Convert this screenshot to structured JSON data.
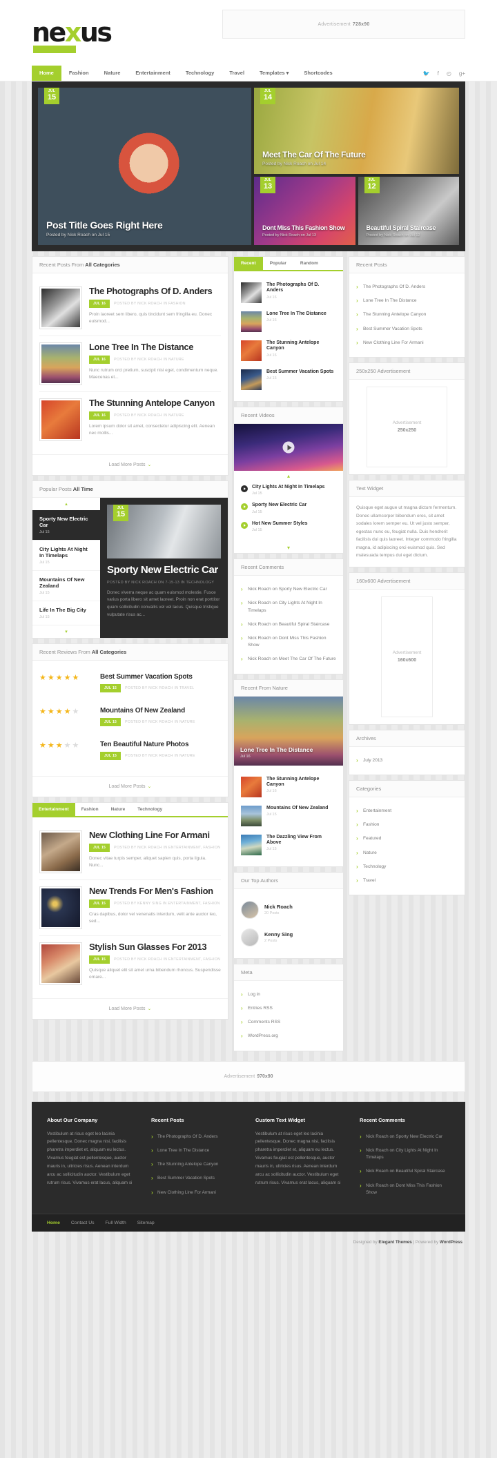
{
  "header": {
    "logo": "nexus",
    "logo_accent_letter": "x",
    "ad_label": "Advertisement",
    "ad_size": "728x90",
    "nav": [
      {
        "label": "Home",
        "active": true
      },
      {
        "label": "Fashion",
        "active": false
      },
      {
        "label": "Nature",
        "active": false
      },
      {
        "label": "Entertainment",
        "active": false
      },
      {
        "label": "Technology",
        "active": false
      },
      {
        "label": "Travel",
        "active": false
      },
      {
        "label": "Templates ▾",
        "active": false
      },
      {
        "label": "Shortcodes",
        "active": false
      }
    ],
    "social": [
      "twitter-icon",
      "facebook-icon",
      "rss-icon",
      "google-plus-icon"
    ]
  },
  "slider": {
    "main": {
      "month": "JUL",
      "day": "15",
      "title": "Post Title Goes Right Here",
      "meta": "Posted by Nick Roach on Jul 15"
    },
    "top": {
      "month": "JUL",
      "day": "14",
      "title": "Meet The Car Of The Future",
      "meta": "Posted by Nick Roach on Jul 14"
    },
    "bottom1": {
      "month": "JUL",
      "day": "13",
      "title": "Dont Miss This Fashion Show",
      "meta": "Posted by Nick Roach on Jul 13"
    },
    "bottom2": {
      "month": "JUL",
      "day": "12",
      "title": "Beautiful Spiral Staircase",
      "meta": "Posted by Nick Roach on Jul 12"
    }
  },
  "recent_posts_module": {
    "header_pre": "Recent Posts From ",
    "header_bold": "All Categories",
    "posts": [
      {
        "title": "The Photographs Of D. Anders",
        "badge": "JUL 16",
        "byline": "POSTED BY NICK ROACH IN FASHION",
        "excerpt": "Proin laoreet sem libero, quis tincidunt sem fringilla eu. Donec euismod...",
        "img": "g-bw"
      },
      {
        "title": "Lone Tree In The Distance",
        "badge": "JUL 16",
        "byline": "POSTED BY NICK ROACH IN NATURE",
        "excerpt": "Nunc rutrum orci pretium, suscipit nisi eget, condimentum neque. Maecenas et...",
        "img": "g-tree"
      },
      {
        "title": "The Stunning Antelope Canyon",
        "badge": "JUL 16",
        "byline": "POSTED BY NICK ROACH IN NATURE",
        "excerpt": "Lorem ipsum dolor sit amet, consectetur adipiscing elit. Aenean nec mollis...",
        "img": "g-canyon"
      }
    ],
    "load_more": "Load More Posts"
  },
  "popular_module": {
    "header_pre": "Popular Posts ",
    "header_bold": "All Time",
    "list": [
      {
        "title": "Sporty New Electric Car",
        "date": "Jul 15",
        "active": true
      },
      {
        "title": "City Lights At Night In Timelaps",
        "date": "Jul 15",
        "active": false
      },
      {
        "title": "Mountains Of New Zealand",
        "date": "Jul 15",
        "active": false
      },
      {
        "title": "Life In The Big City",
        "date": "Jul 15",
        "active": false
      }
    ],
    "feature": {
      "month": "JUL",
      "day": "15",
      "title": "Sporty New Electric Car",
      "meta": "POSTED BY NICK ROACH ON 7-15-13 IN TECHNOLOGY",
      "excerpt": "Donec viverra neque ac quam euismod molestie. Fusce varius porta libero sit amet laoreet. Proin non erat porttitor quam sollicitudin convallis vel vel lacus. Quisque tristique vulputate risus ac..."
    }
  },
  "reviews_module": {
    "header_pre": "Recent Reviews From ",
    "header_bold": "All Categories",
    "reviews": [
      {
        "title": "Best Summer Vacation Spots",
        "stars": 5,
        "badge": "JUL 15",
        "byline": "POSTED BY NICK ROACH IN TRAVEL"
      },
      {
        "title": "Mountains Of New Zealand",
        "stars": 4,
        "badge": "JUL 15",
        "byline": "POSTED BY NICK ROACH IN NATURE"
      },
      {
        "title": "Ten Beautiful Nature Photos",
        "stars": 3,
        "badge": "JUL 15",
        "byline": "POSTED BY NICK ROACH IN NATURE"
      }
    ],
    "load_more": "Load More Posts"
  },
  "category_tabs_module": {
    "tabs": [
      {
        "label": "Entertainment",
        "active": true
      },
      {
        "label": "Fashion",
        "active": false
      },
      {
        "label": "Nature",
        "active": false
      },
      {
        "label": "Technology",
        "active": false
      }
    ],
    "posts": [
      {
        "title": "New Clothing Line For Armani",
        "badge": "JUL 15",
        "byline": "POSTED BY NICK ROACH IN ENTERTAINMENT, FASHION",
        "excerpt": "Donec vitae turpis semper, aliquet sapien quis, porta ligula. Nunc...",
        "img": "g-fashion"
      },
      {
        "title": "New Trends For Men's Fashion",
        "badge": "JUL 15",
        "byline": "POSTED BY KENNY SING IN ENTERTAINMENT, FASHION",
        "excerpt": "Cras dapibus, dolor vel venenatis interdum, velit ante auctor leo, sed...",
        "img": "g-night"
      },
      {
        "title": "Stylish Sun Glasses For 2013",
        "badge": "JUL 15",
        "byline": "POSTED BY NICK ROACH IN ENTERTAINMENT, FASHION",
        "excerpt": "Quisque aliquet elit sit amet urna bibendum rhoncus. Suspendisse ornare...",
        "img": "g-sun"
      }
    ],
    "load_more": "Load More Posts"
  },
  "col_b": {
    "tabs": [
      {
        "label": "Recent",
        "active": true
      },
      {
        "label": "Popular",
        "active": false
      },
      {
        "label": "Random",
        "active": false
      }
    ],
    "tab_posts": [
      {
        "title": "The Photographs Of D. Anders",
        "date": "Jul 16",
        "img": "g-bw"
      },
      {
        "title": "Lone Tree In The Distance",
        "date": "Jul 16",
        "img": "g-tree"
      },
      {
        "title": "The Stunning Antelope Canyon",
        "date": "Jul 16",
        "img": "g-canyon"
      },
      {
        "title": "Best Summer Vacation Spots",
        "date": "Jul 15",
        "img": "g-venice"
      }
    ],
    "videos_title": "Recent Videos",
    "videos": [
      {
        "title": "City Lights At Night In Timelaps",
        "date": "Jul 15",
        "dark": true
      },
      {
        "title": "Sporty New Electric Car",
        "date": "Jul 15",
        "dark": false
      },
      {
        "title": "Hot New Summer Styles",
        "date": "Jul 15",
        "dark": false
      }
    ],
    "comments_title": "Recent Comments",
    "comments": [
      "Nick Roach on Sporty New Electric Car",
      "Nick Roach on City Lights At Night In Timelaps",
      "Nick Roach on Beautiful Spiral Staircase",
      "Nick Roach on Dont Miss This Fashion Show",
      "Nick Roach on Meet The Car Of The Future"
    ],
    "nature_title": "Recent From Nature",
    "nature_hero": {
      "title": "Lone Tree In The Distance",
      "date": "Jul 16"
    },
    "nature_posts": [
      {
        "title": "The Stunning Antelope Canyon",
        "date": "Jul 16",
        "img": "g-canyon"
      },
      {
        "title": "Mountains Of New Zealand",
        "date": "Jul 15",
        "img": "g-mount"
      },
      {
        "title": "The Dazzling View From Above",
        "date": "Jul 15",
        "img": "g-above"
      }
    ],
    "authors_title": "Our Top Authors",
    "authors": [
      {
        "name": "Nick Roach",
        "posts": "20 Posts"
      },
      {
        "name": "Kenny Sing",
        "posts": "2 Posts"
      }
    ],
    "meta_title": "Meta",
    "meta_links": [
      "Log in",
      "Entries RSS",
      "Comments RSS",
      "WordPress.org"
    ]
  },
  "col_c": {
    "recent_posts_title": "Recent Posts",
    "recent_posts": [
      "The Photographs Of D. Anders",
      "Lone Tree In The Distance",
      "The Stunning Antelope Canyon",
      "Best Summer Vacation Spots",
      "New Clothing Line For Armani"
    ],
    "ad250_title": "250x250 Advertisement",
    "ad250_label": "Advertisement",
    "ad250_size": "250x250",
    "text_widget_title": "Text Widget",
    "text_widget_body": "Quisque eget augue ut magna dictum fermentum. Donec ullamcorper bibendum eros, sit amet sodales lorem semper eu. Ut vel justo semper, egestas nunc eu, feugiat nulla. Duis hendrerit facilisis dui quis laoreet. Integer commodo fringilla magna, id adipiscing orci euismod quis. Sed malesuada tempus dui eget dictum.",
    "ad160_title": "160x600 Advertisement",
    "ad160_label": "Advertisement",
    "ad160_size": "160x600",
    "archives_title": "Archives",
    "archives": [
      "July 2013"
    ],
    "categories_title": "Categories",
    "categories": [
      "Entertainment",
      "Fashion",
      "Featured",
      "Nature",
      "Technology",
      "Travel"
    ]
  },
  "ad970": {
    "label": "Advertisement",
    "size": "970x90"
  },
  "footer": {
    "columns": [
      {
        "title": "About Our Company",
        "body": "Vestibulum at risus eget leo lacinia pellentesque. Donec magna nisi, facilisis pharetra imperdiet et, aliquam eu lectus. Vivamus feugiat est pellentesque, auctor mauris in, ultricies risus. Aenean interdum arcu ac sollicitudin auctor. Vestibulum eget rutrum risus. Vivamus erat lacus, aliquam si"
      },
      {
        "title": "Recent Posts",
        "items": [
          "The Photographs Of D. Anders",
          "Lone Tree In The Distance",
          "The Stunning Antelope Canyon",
          "Best Summer Vacation Spots",
          "New Clothing Line For Armani"
        ]
      },
      {
        "title": "Custom Text Widget",
        "body": "Vestibulum at risus eget leo lacinia pellentesque. Donec magna nisi, facilisis pharetra imperdiet et, aliquam eu lectus. Vivamus feugiat est pellentesque, auctor mauris in, ultricies risus. Aenean interdum arcu ac sollicitudin auctor. Vestibulum eget rutrum risus. Vivamus erat lacus, aliquam si"
      },
      {
        "title": "Recent Comments",
        "items": [
          "Nick Roach on Sporty New Electric Car",
          "Nick Roach on City Lights At Night In Timelaps",
          "Nick Roach on Beautiful Spiral Staircase",
          "Nick Roach on Dont Miss This Fashion Show"
        ]
      }
    ],
    "bottom_nav": [
      {
        "label": "Home",
        "active": true
      },
      {
        "label": "Contact Us",
        "active": false
      },
      {
        "label": "Full Width",
        "active": false
      },
      {
        "label": "Sitemap",
        "active": false
      }
    ],
    "credit_pre": "Designed by ",
    "credit_brand1": "Elegant Themes",
    "credit_mid": " | Powered by ",
    "credit_brand2": "WordPress"
  },
  "colors": {
    "accent": "#a4cf2d",
    "dark": "#2b2b2b",
    "star": "#f4b61a"
  }
}
